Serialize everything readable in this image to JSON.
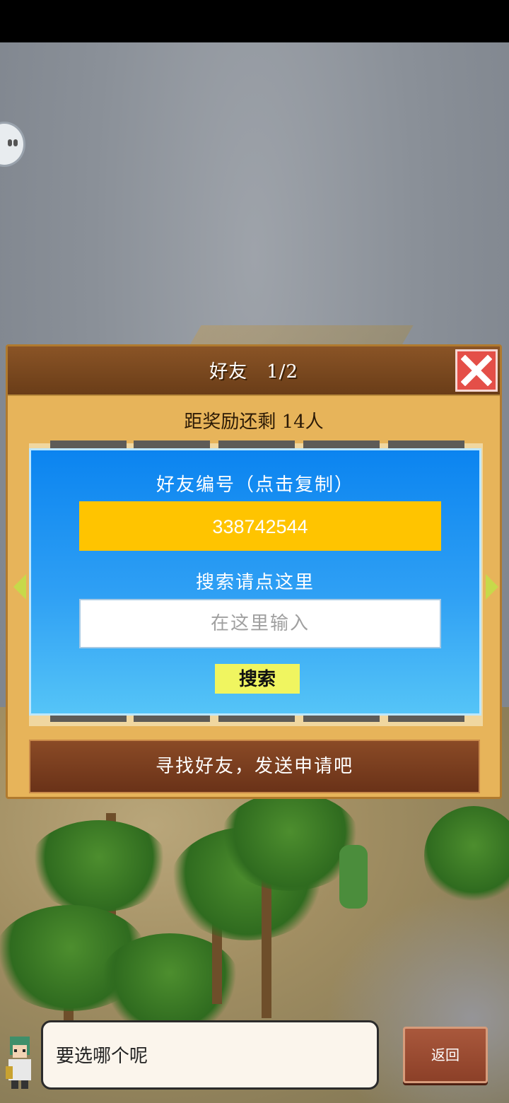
{
  "panel": {
    "title": "好友　1/2",
    "close_icon": "close-icon",
    "reward_text": "距奖励还剩 14人"
  },
  "friend_code": {
    "label": "好友编号（点击复制）",
    "value": "338742544"
  },
  "search": {
    "label": "搜索请点这里",
    "placeholder": "在这里输入",
    "button_label": "搜索"
  },
  "find_bar": {
    "label": "寻找好友，发送申请吧"
  },
  "dialogue": {
    "text": "要选哪个呢"
  },
  "back_button": {
    "label": "返回"
  },
  "colors": {
    "accent_yellow": "#ffc400",
    "panel_brown": "#7a461d",
    "close_red": "#e44f48",
    "search_blue": "#1a8ff1"
  }
}
